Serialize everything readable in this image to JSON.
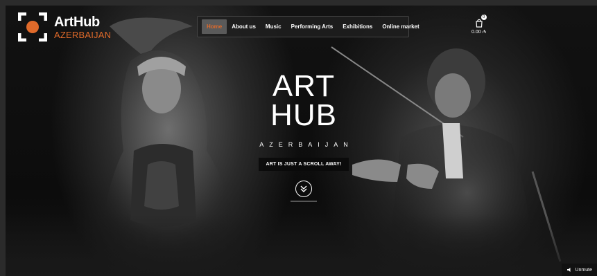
{
  "brand": {
    "title": "ArtHub",
    "subtitle": "AZERBAIJAN",
    "accent": "#e06a2a"
  },
  "nav": {
    "items": [
      {
        "label": "Home",
        "active": true
      },
      {
        "label": "About us"
      },
      {
        "label": "Music"
      },
      {
        "label": "Performing Arts"
      },
      {
        "label": "Exhibitions"
      },
      {
        "label": "Online market"
      }
    ]
  },
  "cart": {
    "icon": "shopping-bag-icon",
    "count": "0",
    "total": "0.00 ₼"
  },
  "hero": {
    "title_line1": "ART",
    "title_line2": "HUB",
    "subtitle": "AZERBAIJAN",
    "tagline": "ART IS JUST A SCROLL AWAY!",
    "scroll_icon": "double-chevron-down-icon"
  },
  "video": {
    "unmute_label": "Unmute",
    "icon": "speaker-icon"
  }
}
